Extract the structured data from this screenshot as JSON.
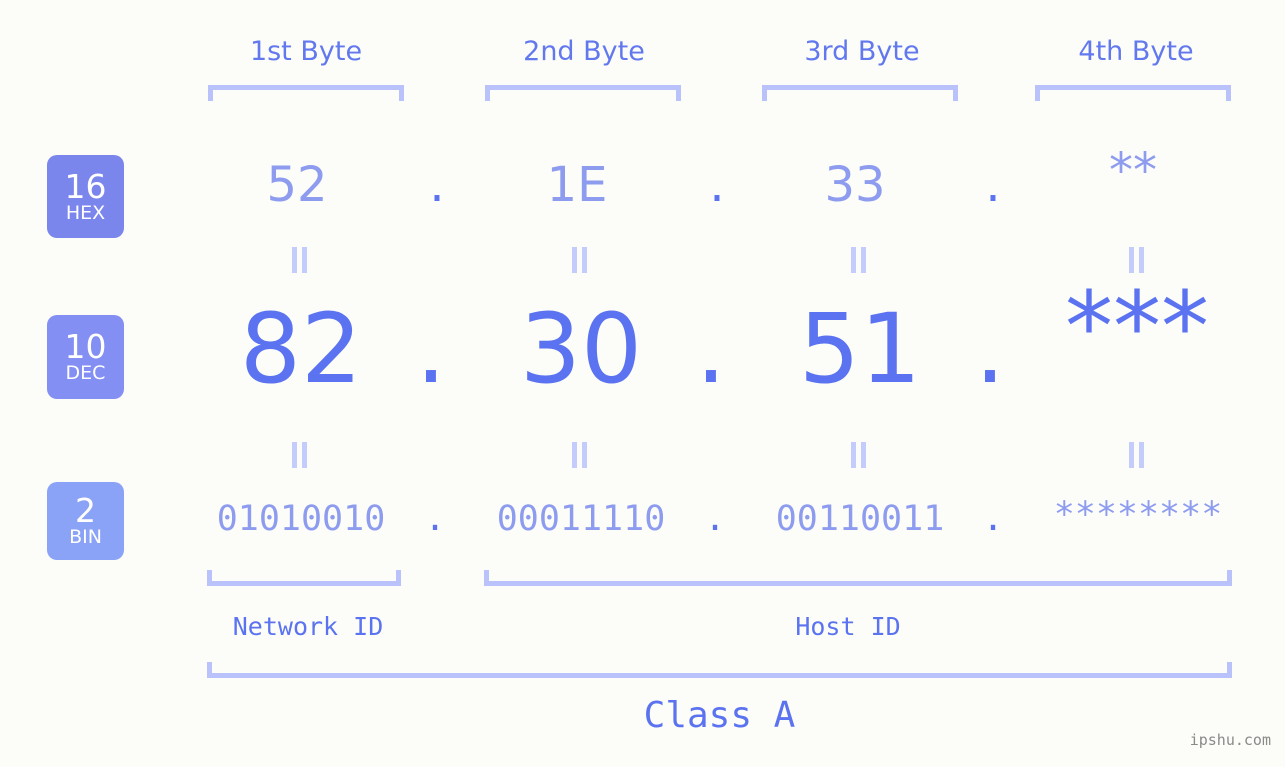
{
  "meta": {
    "background_color": "#fcfdf8",
    "accent_color": "#5b73f0",
    "accent_light_color": "#8e9cf0",
    "bracket_color": "#b9c2fb"
  },
  "byte_headers": [
    {
      "label": "1st Byte"
    },
    {
      "label": "2nd Byte"
    },
    {
      "label": "3rd Byte"
    },
    {
      "label": "4th Byte"
    }
  ],
  "bases": [
    {
      "number": "16",
      "name": "HEX",
      "color": "#7b86ec"
    },
    {
      "number": "10",
      "name": "DEC",
      "color": "#838ff3"
    },
    {
      "number": "2",
      "name": "BIN",
      "color": "#8ba3f7"
    }
  ],
  "rows": {
    "hex": {
      "base_number": "16",
      "base_name": "HEX",
      "values": [
        "52",
        "1E",
        "33",
        "**"
      ],
      "separator": "."
    },
    "dec": {
      "base_number": "10",
      "base_name": "DEC",
      "values": [
        "82",
        "30",
        "51",
        "***"
      ],
      "separator": "."
    },
    "bin": {
      "base_number": "2",
      "base_name": "BIN",
      "values": [
        "01010010",
        "00011110",
        "00110011",
        "********"
      ],
      "separator": "."
    }
  },
  "equals_symbol": "=",
  "id_sections": [
    {
      "label": "Network ID"
    },
    {
      "label": "Host ID"
    }
  ],
  "class_label": "Class A",
  "watermark": "ipshu.com"
}
